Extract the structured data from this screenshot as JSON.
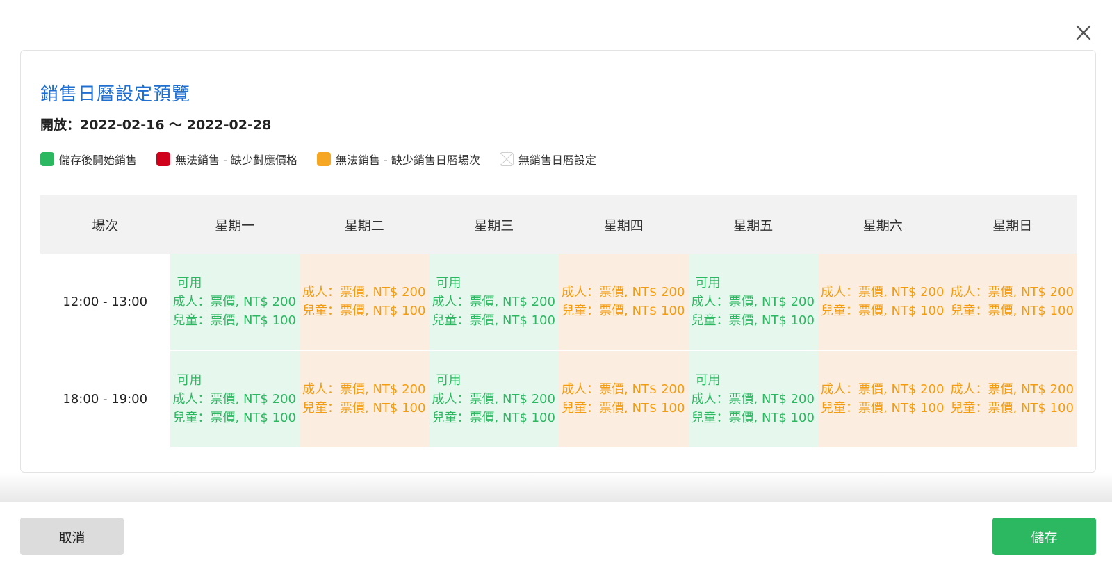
{
  "colors": {
    "title": "#1f6fd0",
    "on_sale": "#2cb761",
    "no_price": "#d0021b",
    "no_session": "#f5a623",
    "cell_green_bg": "#e6f8ee",
    "cell_orange_bg": "#fbeee0"
  },
  "dialog": {
    "close_icon": "close-icon",
    "title": "銷售日曆設定預覽",
    "period": "開放：2022-02-16 ～ 2022-02-28"
  },
  "legend": [
    {
      "label": "儲存後開始銷售",
      "color": "#2cb761"
    },
    {
      "label": "無法銷售 - 缺少對應價格",
      "color": "#d0021b"
    },
    {
      "label": "無法銷售 - 缺少銷售日曆場次",
      "color": "#f5a623"
    },
    {
      "label": "無銷售日曆設定",
      "color": "none"
    }
  ],
  "table": {
    "headers": [
      "場次",
      "星期一",
      "星期二",
      "星期三",
      "星期四",
      "星期五",
      "星期六",
      "星期日"
    ],
    "rows": [
      {
        "slot": "12:00 - 13:00",
        "cells": [
          {
            "status": "green",
            "available": "可用",
            "adult": "成人：票價, NT$ 200",
            "child": "兒童：票價, NT$ 100"
          },
          {
            "status": "orange",
            "available": "",
            "adult": "成人：票價, NT$ 200",
            "child": "兒童：票價, NT$ 100"
          },
          {
            "status": "green",
            "available": "可用",
            "adult": "成人：票價, NT$ 200",
            "child": "兒童：票價, NT$ 100"
          },
          {
            "status": "orange",
            "available": "",
            "adult": "成人：票價, NT$ 200",
            "child": "兒童：票價, NT$ 100"
          },
          {
            "status": "green",
            "available": "可用",
            "adult": "成人：票價, NT$ 200",
            "child": "兒童：票價, NT$ 100"
          },
          {
            "status": "orange",
            "available": "",
            "adult": "成人：票價, NT$ 200",
            "child": "兒童：票價, NT$ 100"
          },
          {
            "status": "orange",
            "available": "",
            "adult": "成人：票價, NT$ 200",
            "child": "兒童：票價, NT$ 100"
          }
        ]
      },
      {
        "slot": "18:00 - 19:00",
        "cells": [
          {
            "status": "green",
            "available": "可用",
            "adult": "成人：票價, NT$ 200",
            "child": "兒童：票價, NT$ 100"
          },
          {
            "status": "orange",
            "available": "",
            "adult": "成人：票價, NT$ 200",
            "child": "兒童：票價, NT$ 100"
          },
          {
            "status": "green",
            "available": "可用",
            "adult": "成人：票價, NT$ 200",
            "child": "兒童：票價, NT$ 100"
          },
          {
            "status": "orange",
            "available": "",
            "adult": "成人：票價, NT$ 200",
            "child": "兒童：票價, NT$ 100"
          },
          {
            "status": "green",
            "available": "可用",
            "adult": "成人：票價, NT$ 200",
            "child": "兒童：票價, NT$ 100"
          },
          {
            "status": "orange",
            "available": "",
            "adult": "成人：票價, NT$ 200",
            "child": "兒童：票價, NT$ 100"
          },
          {
            "status": "orange",
            "available": "",
            "adult": "成人：票價, NT$ 200",
            "child": "兒童：票價, NT$ 100"
          }
        ]
      }
    ]
  },
  "footer": {
    "cancel_label": "取消",
    "save_label": "儲存"
  }
}
